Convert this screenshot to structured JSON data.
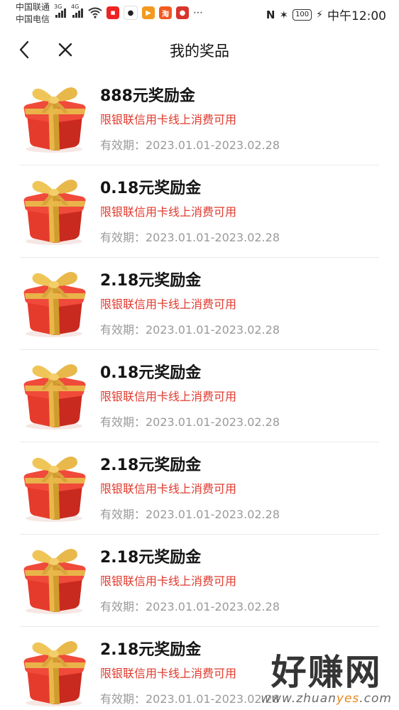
{
  "status_bar": {
    "carrier_1": "中国联通",
    "carrier_2": "中国电信",
    "signal_1": "3G",
    "signal_2": "4G",
    "battery": "100",
    "time": "中午12:00",
    "icons": [
      "signal-icon",
      "wifi-icon",
      "app-icon",
      "qq-icon",
      "video-app-icon",
      "taobao-icon",
      "app-icon",
      "more-icon",
      "nfc-icon",
      "bluetooth-icon",
      "battery-icon",
      "charging-icon"
    ]
  },
  "nav": {
    "title": "我的奖品",
    "back_icon": "back-arrow-icon",
    "close_icon": "close-icon"
  },
  "prizes": [
    {
      "title": "888元奖励金",
      "limit": "限银联信用卡线上消费可用",
      "validity": "有效期：2023.01.01-2023.02.28",
      "icon": "gift-icon"
    },
    {
      "title": "0.18元奖励金",
      "limit": "限银联信用卡线上消费可用",
      "validity": "有效期：2023.01.01-2023.02.28",
      "icon": "gift-icon"
    },
    {
      "title": "2.18元奖励金",
      "limit": "限银联信用卡线上消费可用",
      "validity": "有效期：2023.01.01-2023.02.28",
      "icon": "gift-icon"
    },
    {
      "title": "0.18元奖励金",
      "limit": "限银联信用卡线上消费可用",
      "validity": "有效期：2023.01.01-2023.02.28",
      "icon": "gift-icon"
    },
    {
      "title": "2.18元奖励金",
      "limit": "限银联信用卡线上消费可用",
      "validity": "有效期：2023.01.01-2023.02.28",
      "icon": "gift-icon"
    },
    {
      "title": "2.18元奖励金",
      "limit": "限银联信用卡线上消费可用",
      "validity": "有效期：2023.01.01-2023.02.28",
      "icon": "gift-icon"
    },
    {
      "title": "2.18元奖励金",
      "limit": "限银联信用卡线上消费可用",
      "validity": "有效期：2023.01.01-2023.02.28",
      "icon": "gift-icon"
    }
  ],
  "watermark": {
    "text": "好赚网",
    "url_prefix": "www.zhuan",
    "url_highlight": "yes",
    "url_suffix": ".com"
  },
  "colors": {
    "limit_text": "#e03a2e",
    "validity_text": "#9a9a9a",
    "gift_red": "#e53b2c",
    "gift_gold": "#e8b84a"
  }
}
